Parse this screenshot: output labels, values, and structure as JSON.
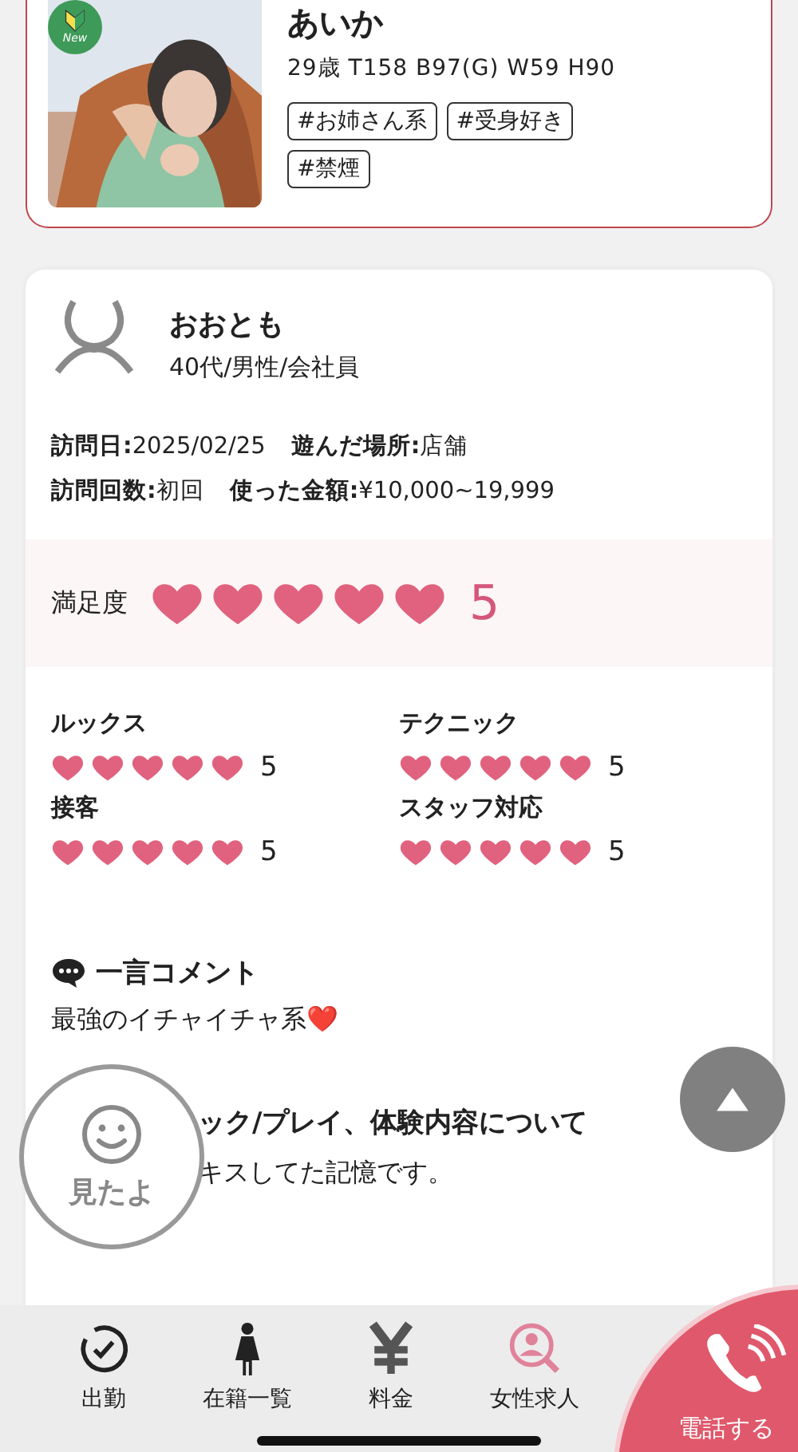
{
  "cast": {
    "badge": "New",
    "name": "あいか",
    "stats": "29歳 T158 B97(G) W59 H90",
    "tags": [
      "#お姉さん系",
      "#受身好き",
      "#禁煙"
    ],
    "photo": {
      "kind": "picture"
    }
  },
  "review": {
    "reviewer": "おおとも",
    "profile": "40代/男性/会社員",
    "info": [
      [
        {
          "label": "訪問日:",
          "value": "2025/02/25"
        },
        {
          "label": "遊んだ場所:",
          "value": "店舗"
        }
      ],
      [
        {
          "label": "訪問回数:",
          "value": "初回"
        },
        {
          "label": "使った金額:",
          "value": "¥10,000~19,999"
        }
      ]
    ],
    "satisfaction": {
      "label": "満足度",
      "stars": 5,
      "score": "5"
    },
    "ratings": [
      {
        "label": "ルックス",
        "stars": 5,
        "score": "5"
      },
      {
        "label": "テクニック",
        "stars": 5,
        "score": "5"
      },
      {
        "label": "接客",
        "stars": 5,
        "score": "5"
      },
      {
        "label": "スタッフ対応",
        "stars": 5,
        "score": "5"
      }
    ],
    "comment_title": "一言コメント",
    "comment": "最強のイチャイチャ系❤️",
    "detail_title": "ック/プレイ、体験内容について",
    "detail": "キスしてた記憶です。"
  },
  "seen_button": "見たよ",
  "nav": [
    {
      "kind": "clock",
      "label": "出勤"
    },
    {
      "kind": "woman",
      "label": "在籍一覧"
    },
    {
      "kind": "yen",
      "label": "料金"
    },
    {
      "kind": "search-person",
      "label": "女性求人"
    }
  ],
  "call_button": "電話する"
}
